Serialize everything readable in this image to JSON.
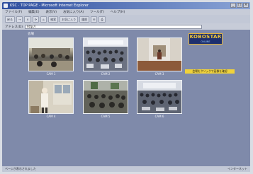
{
  "window": {
    "title": "KSC · TOP PAGE - Microsoft Internet Explorer",
    "controls": [
      "_",
      "□",
      "×"
    ]
  },
  "menubar": {
    "items": [
      "ファイル(F)",
      "編集(E)",
      "表示(V)",
      "お気に入り(A)",
      "ツール(T)",
      "ヘルプ(H)"
    ]
  },
  "toolbar": {
    "buttons": [
      "戻る",
      "→",
      "×",
      "⟳",
      "⌂",
      "検索",
      "お気に入り",
      "履歴",
      "✉",
      "⎙"
    ]
  },
  "addressbar": {
    "label": "アドレス(D)",
    "value": "http://"
  },
  "content": {
    "header": "会場",
    "cameras": [
      {
        "label": "CAM 1"
      },
      {
        "label": "CAM 2"
      },
      {
        "label": "CAM 3"
      },
      {
        "label": "CAM 4"
      },
      {
        "label": "CAM 5"
      },
      {
        "label": "CAM 6"
      }
    ],
    "logo": {
      "main": "KOBOSTAR",
      "sub": "ONLINE"
    },
    "banner": "会場をクリックで画像を確認"
  },
  "statusbar": {
    "text": "ページが表示されました",
    "zone": "インターネット"
  }
}
